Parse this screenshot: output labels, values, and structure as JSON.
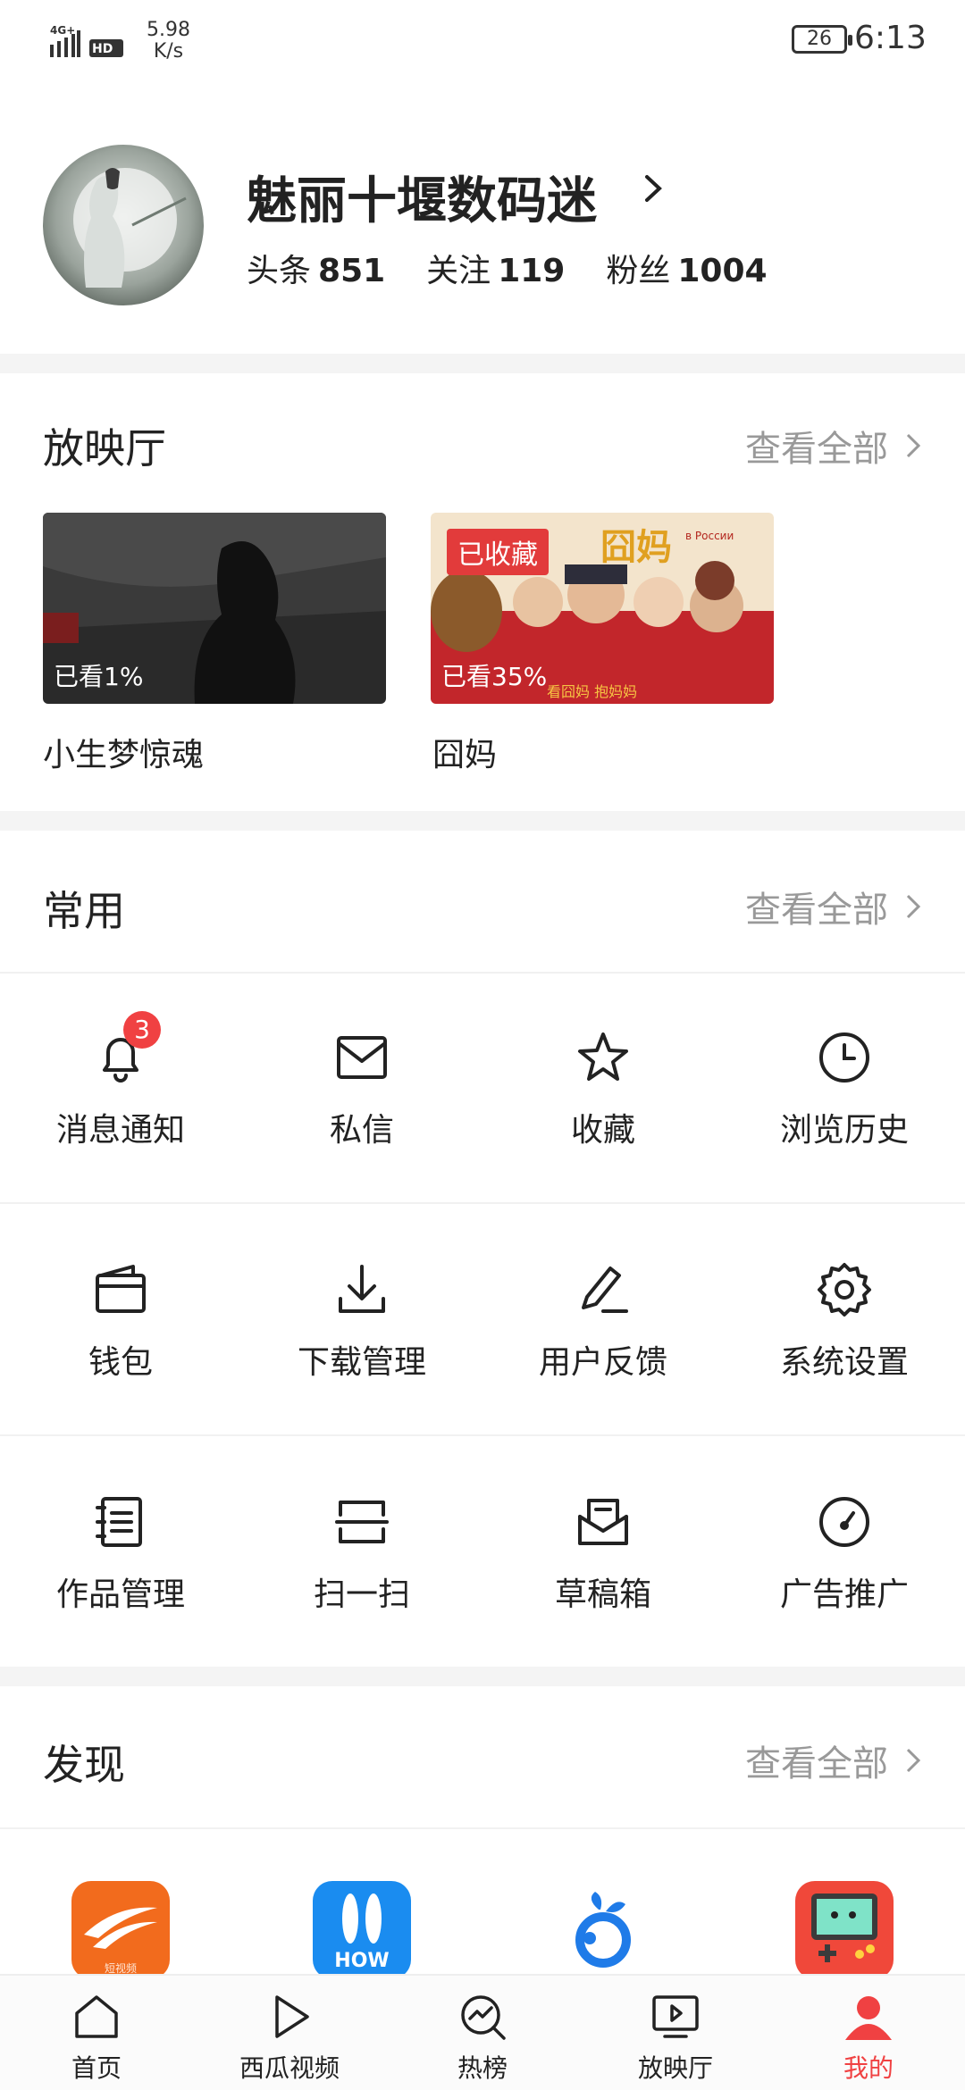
{
  "status_bar": {
    "network": "4G",
    "hd": "HD",
    "speed_value": "5.98",
    "speed_unit": "K/s",
    "battery": "26",
    "time": "6:13"
  },
  "profile": {
    "name": "魅丽十堰数码迷",
    "stats": [
      {
        "label": "头条",
        "value": "851"
      },
      {
        "label": "关注",
        "value": "119"
      },
      {
        "label": "粉丝",
        "value": "1004"
      }
    ]
  },
  "theater": {
    "title": "放映厅",
    "view_all": "查看全部",
    "items": [
      {
        "title": "小生梦惊魂",
        "progress": "已看1%",
        "badge": ""
      },
      {
        "title": "囧妈",
        "progress": "已看35%",
        "badge": "已收藏"
      }
    ]
  },
  "common": {
    "title": "常用",
    "view_all": "查看全部",
    "items": [
      {
        "label": "消息通知",
        "icon": "bell-icon",
        "badge": "3"
      },
      {
        "label": "私信",
        "icon": "mail-icon"
      },
      {
        "label": "收藏",
        "icon": "star-icon"
      },
      {
        "label": "浏览历史",
        "icon": "clock-icon"
      },
      {
        "label": "钱包",
        "icon": "wallet-icon"
      },
      {
        "label": "下载管理",
        "icon": "download-icon"
      },
      {
        "label": "用户反馈",
        "icon": "pen-icon"
      },
      {
        "label": "系统设置",
        "icon": "gear-icon"
      },
      {
        "label": "作品管理",
        "icon": "notebook-icon"
      },
      {
        "label": "扫一扫",
        "icon": "scan-icon"
      },
      {
        "label": "草稿箱",
        "icon": "inbox-icon"
      },
      {
        "label": "广告推广",
        "icon": "gauge-icon"
      }
    ]
  },
  "discover": {
    "title": "发现",
    "view_all": "查看全部",
    "apps": [
      {
        "icon": "short-video-app-icon",
        "caption": "短视频"
      },
      {
        "icon": "how-app-icon",
        "caption": "HOW"
      },
      {
        "icon": "fruit-app-icon",
        "caption": ""
      },
      {
        "icon": "game-app-icon",
        "caption": ""
      }
    ]
  },
  "bottom_nav": [
    {
      "label": "首页",
      "icon": "home-icon"
    },
    {
      "label": "西瓜视频",
      "icon": "play-icon"
    },
    {
      "label": "热榜",
      "icon": "trend-search-icon"
    },
    {
      "label": "放映厅",
      "icon": "tv-play-icon"
    },
    {
      "label": "我的",
      "icon": "person-icon",
      "active": true
    }
  ],
  "colors": {
    "accent": "#f04142",
    "muted": "#999999",
    "divider": "#f4f4f4"
  }
}
